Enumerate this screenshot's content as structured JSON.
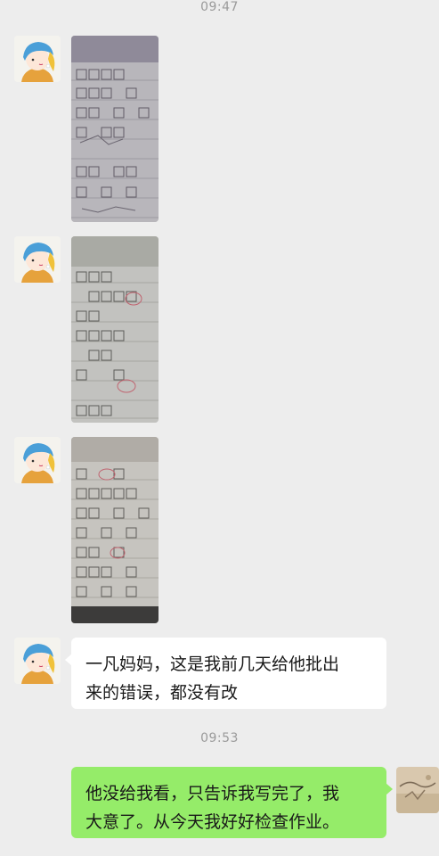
{
  "timestamps": [
    "09:47",
    "09:53"
  ],
  "messages": {
    "teacher_text": {
      "line1": "一凡妈妈，这是我前几天给他批出",
      "line2": "来的错误，都没有改"
    },
    "parent_reply": {
      "line1": "他没给我看，只告诉我写完了，我",
      "line2": "大意了。从今天我好好检查作业。"
    }
  },
  "colors": {
    "background": "#ededed",
    "incoming_bubble": "#ffffff",
    "outgoing_bubble": "#95ec69",
    "timestamp": "#9a9a9a"
  }
}
